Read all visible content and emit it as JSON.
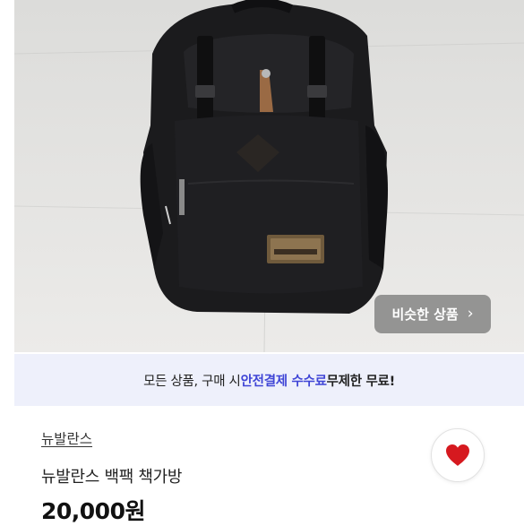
{
  "similar_button": {
    "label": "비슷한 상품",
    "icon": "chevron-right-icon"
  },
  "banner": {
    "part1": "모든 상품, 구매 시 ",
    "highlight": "안전결제 수수료",
    "part2": " ",
    "bold": "무제한 무료!",
    "accent_color": "#3f45d6"
  },
  "product": {
    "brand": "뉴발란스",
    "title": "뉴발란스 백팩 책가방",
    "price": "20,000원"
  },
  "like_button": {
    "icon": "heart-icon",
    "color": "#d6191f"
  }
}
